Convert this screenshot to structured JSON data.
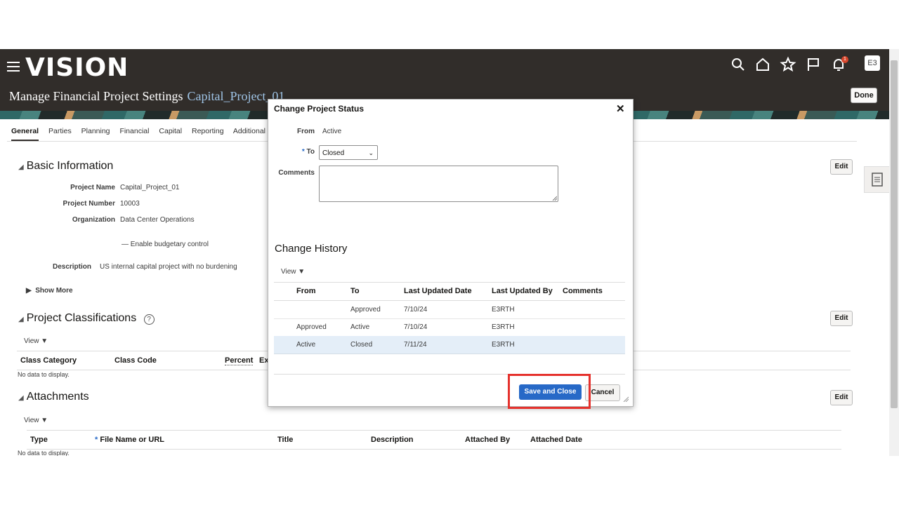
{
  "header": {
    "brand": "VISION",
    "page_title": "Manage Financial Project Settings",
    "project_name": "Capital_Project_01",
    "notification_count": "1",
    "user_initials": "E3",
    "done_label": "Done"
  },
  "tabs": [
    "General",
    "Parties",
    "Planning",
    "Financial",
    "Capital",
    "Reporting",
    "Additional In"
  ],
  "basic_info": {
    "title": "Basic Information",
    "project_name_label": "Project Name",
    "project_name": "Capital_Project_01",
    "project_number_label": "Project Number",
    "project_number": "10003",
    "organization_label": "Organization",
    "organization": "Data Center Operations",
    "budgetary_control": "Enable budgetary control",
    "description_label": "Description",
    "description": "US internal capital project with no burdening",
    "show_more": "Show More",
    "edit_label": "Edit"
  },
  "classifications": {
    "title": "Project Classifications",
    "view_label": "View",
    "headers": [
      "Class Category",
      "Class Code",
      "Percent",
      "Ex"
    ],
    "empty": "No data to display.",
    "edit_label": "Edit"
  },
  "attachments": {
    "title": "Attachments",
    "view_label": "View",
    "headers": [
      "Type",
      "File Name or URL",
      "Title",
      "Description",
      "Attached By",
      "Attached Date"
    ],
    "empty": "No data to display.",
    "edit_label": "Edit"
  },
  "dialog": {
    "title": "Change Project Status",
    "from_label": "From",
    "from_value": "Active",
    "to_label": "To",
    "to_value": "Closed",
    "comments_label": "Comments",
    "history_title": "Change History",
    "view_label": "View",
    "history_headers": [
      "From",
      "To",
      "Last Updated Date",
      "Last Updated By",
      "Comments"
    ],
    "history_rows": [
      {
        "from": "",
        "to": "Approved",
        "date": "7/10/24",
        "by": "E3RTH",
        "comments": ""
      },
      {
        "from": "Approved",
        "to": "Active",
        "date": "7/10/24",
        "by": "E3RTH",
        "comments": ""
      },
      {
        "from": "Active",
        "to": "Closed",
        "date": "7/11/24",
        "by": "E3RTH",
        "comments": ""
      }
    ],
    "save_label": "Save and Close",
    "cancel_label": "Cancel"
  }
}
